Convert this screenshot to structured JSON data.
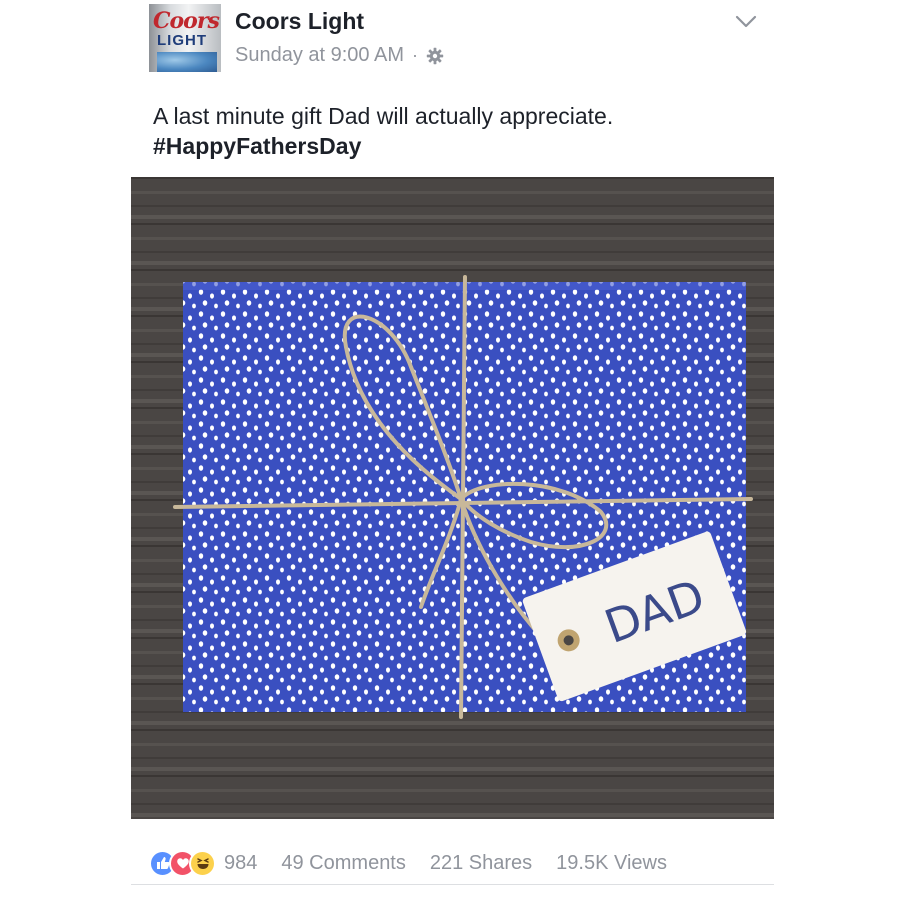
{
  "post": {
    "page_name": "Coors Light",
    "avatar_brand_line1": "Coors",
    "avatar_brand_line2": "LIGHT",
    "timestamp": "Sunday at 9:00 AM",
    "separator": "·",
    "audience_icon": "gear-icon",
    "menu_icon": "chevron-down-icon",
    "message": "A last minute gift Dad will actually appreciate.",
    "hashtag": "#HappyFathersDay",
    "photo": {
      "tag_text": "DAD",
      "wrapping_color": "#3a4fc0",
      "table_color": "#4a4644"
    }
  },
  "footer": {
    "reaction_icons": [
      "like-icon",
      "love-icon",
      "haha-icon"
    ],
    "reaction_count": "984",
    "comments": "49 Comments",
    "shares": "221 Shares",
    "views": "19.5K Views"
  },
  "colors": {
    "text_primary": "#1d2129",
    "text_secondary": "#90949c",
    "like_blue": "#5890ff",
    "love_red": "#f25268",
    "haha_yellow": "#fcd14c"
  }
}
